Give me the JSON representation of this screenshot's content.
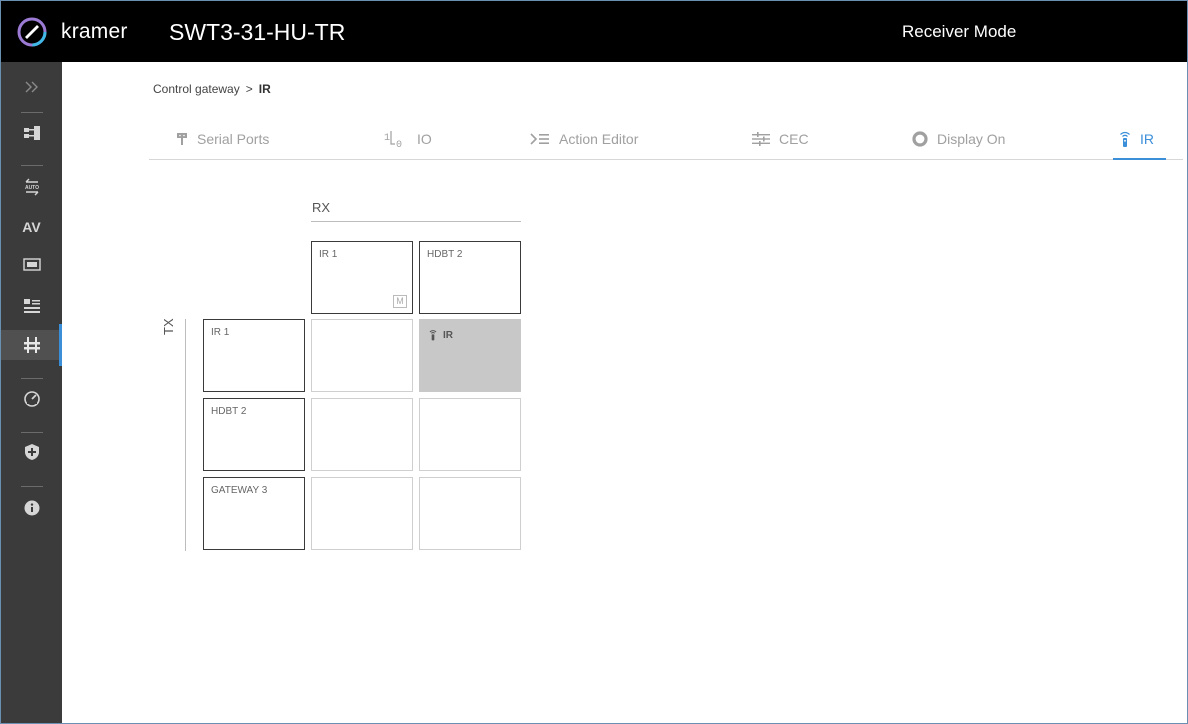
{
  "header": {
    "brand": "kramer",
    "device_name": "SWT3-31-HU-TR",
    "mode": "Receiver Mode"
  },
  "sidebar": {
    "items": [
      {
        "icon": "chevron-double-right-icon"
      },
      {
        "icon": "network-icon"
      },
      {
        "icon": "auto-switching-icon"
      },
      {
        "icon": "av-icon",
        "label": "AV"
      },
      {
        "icon": "edid-icon"
      },
      {
        "icon": "settings-panel-icon"
      },
      {
        "icon": "control-icon",
        "active": true
      },
      {
        "icon": "diagnostics-gauge-icon"
      },
      {
        "icon": "security-shield-icon"
      },
      {
        "icon": "info-icon"
      }
    ],
    "active_color": "#3b8fd9"
  },
  "breadcrumb": {
    "parent": "Control gateway",
    "separator": ">",
    "current": "IR"
  },
  "tabs": [
    {
      "label": "Serial Ports",
      "icon": "serial-port-icon"
    },
    {
      "label": "IO",
      "icon": "io-icon"
    },
    {
      "label": "Action Editor",
      "icon": "action-editor-icon"
    },
    {
      "label": "CEC",
      "icon": "cec-icon"
    },
    {
      "label": "Display On",
      "icon": "display-on-icon"
    },
    {
      "label": "IR",
      "icon": "ir-remote-icon",
      "active": true
    }
  ],
  "matrix": {
    "rx_title": "RX",
    "tx_title": "TX",
    "rx_ports": [
      "IR 1",
      "HDBT 2"
    ],
    "rx_badge": "M",
    "tx_ports": [
      "IR 1",
      "HDBT 2",
      "GATEWAY 3"
    ],
    "route_label": "IR",
    "routes": [
      {
        "tx": "IR 1",
        "rx": "HDBT 2"
      }
    ]
  },
  "colors": {
    "header_bg": "#000000",
    "sidebar_bg": "#3b3b3b",
    "accent": "#3b8fd9",
    "routed_cell": "#c8c8c8"
  }
}
